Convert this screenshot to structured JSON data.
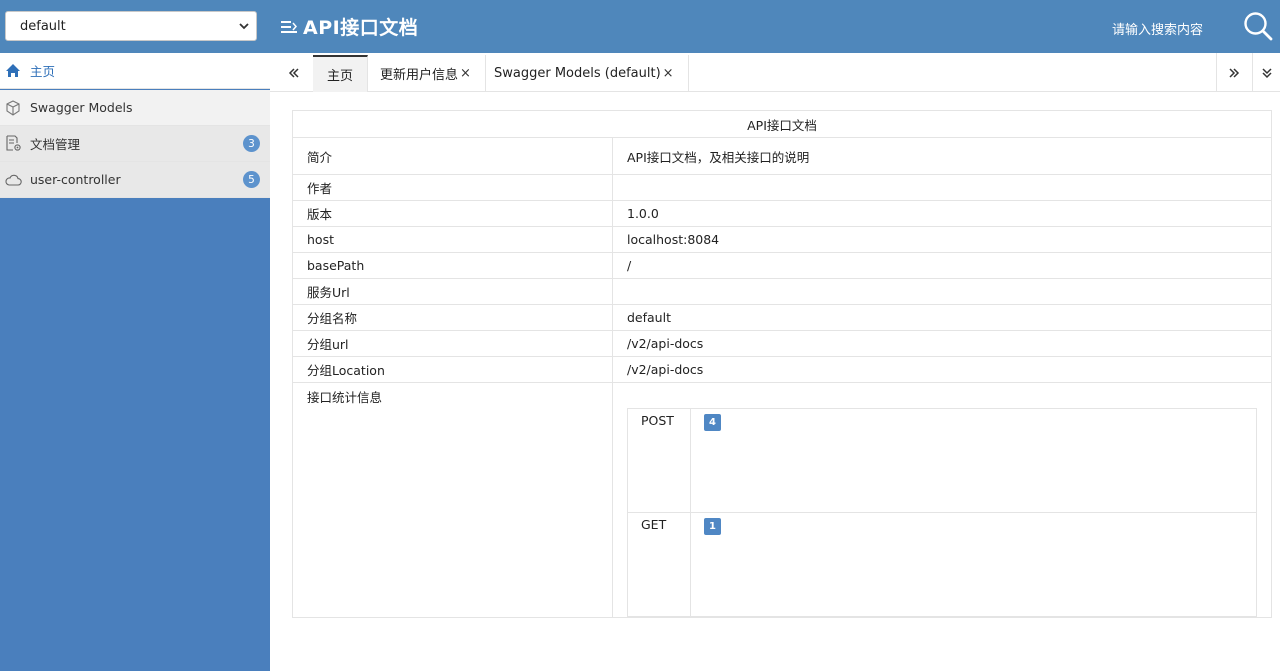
{
  "header": {
    "group_select": "default",
    "title": "API接口文档",
    "search_placeholder": "请输入搜索内容"
  },
  "sidebar": {
    "items": [
      {
        "label": "主页",
        "icon": "home-icon"
      },
      {
        "label": "Swagger Models",
        "icon": "cube-icon"
      },
      {
        "label": "文档管理",
        "icon": "document-settings-icon",
        "badge": "3"
      },
      {
        "label": "user-controller",
        "icon": "cloud-icon",
        "badge": "5"
      }
    ]
  },
  "tabs": [
    {
      "label": "主页",
      "closable": false
    },
    {
      "label": "更新用户信息",
      "close": "×"
    },
    {
      "label": "Swagger Models (default)",
      "close": "×"
    }
  ],
  "info": {
    "heading": "API接口文档",
    "rows": [
      {
        "key": "简介",
        "value": "API接口文档，及相关接口的说明"
      },
      {
        "key": "作者",
        "value": ""
      },
      {
        "key": "版本",
        "value": "1.0.0"
      },
      {
        "key": "host",
        "value": "localhost:8084"
      },
      {
        "key": "basePath",
        "value": "/"
      },
      {
        "key": "服务Url",
        "value": ""
      },
      {
        "key": "分组名称",
        "value": "default"
      },
      {
        "key": "分组url",
        "value": "/v2/api-docs"
      },
      {
        "key": "分组Location",
        "value": "/v2/api-docs"
      }
    ],
    "stats_label": "接口统计信息",
    "stats": [
      {
        "method": "POST",
        "count": "4"
      },
      {
        "method": "GET",
        "count": "1"
      }
    ]
  },
  "colors": {
    "topbar": "#4f87bb",
    "sidebar": "#4a7fbd",
    "badge": "#5d93cd",
    "count_badge": "#4f87c4"
  }
}
